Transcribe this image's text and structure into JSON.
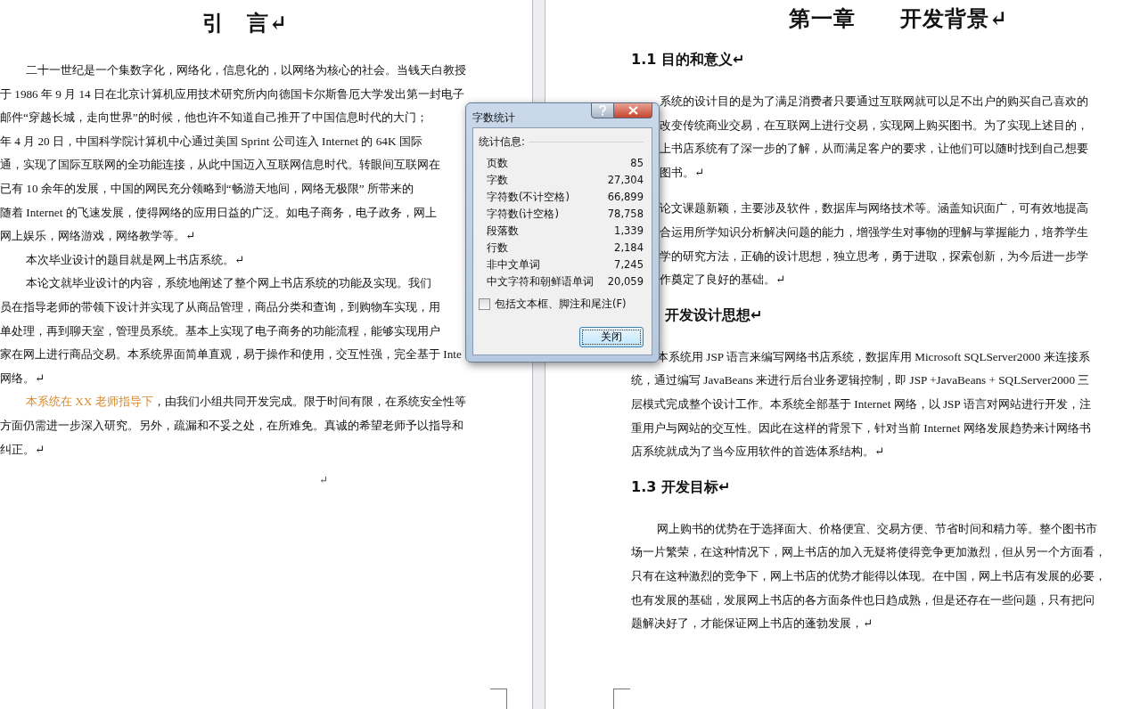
{
  "left_page": {
    "title": "引　言↵",
    "blocks": [
      {
        "kind": "para",
        "lines": [
          "二十一世纪是一个集数字化，网络化，信息化的，以网络为核心的社会。当钱天白教授",
          "于 1986 年 9 月 14 日在北京计算机应用技术研究所内向德国卡尔斯鲁厄大学发出第一封电子",
          "邮件“穿越长城，走向世界”的时候，他也许不知道自己推开了中国信息时代的大门；",
          "年 4 月 20 日，中国科学院计算机中心通过美国 Sprint 公司连入 Internet 的 64K 国际",
          "通，实现了国际互联网的全功能连接，从此中国迈入互联网信息时代。转眼间互联网在",
          "已有 10 余年的发展，中国的网民充分领略到“畅游天地间，网络无极限” 所带来的",
          "随着 Internet 的飞速发展，使得网络的应用日益的广泛。如电子商务，电子政务，网上",
          "网上娱乐，网络游戏，网络教学等。↵"
        ]
      },
      {
        "kind": "para",
        "lines": [
          "本次毕业设计的题目就是网上书店系统。↵"
        ]
      },
      {
        "kind": "para",
        "lines": [
          "本论文就毕业设计的内容，系统地阐述了整个网上书店系统的功能及实现。我们",
          "员在指导老师的带领下设计并实现了从商品管理，商品分类和查询，到购物车实现，用",
          "单处理，再到聊天室，管理员系统。基本上实现了电子商务的功能流程，能够实现用户",
          "家在网上进行商品交易。本系统界面简单直观，易于操作和使用，交互性强，完全基于 Inte",
          "网络。↵"
        ]
      },
      {
        "kind": "para",
        "lines": [
          {
            "spans": [
              {
                "text": "本系统在 XX 老师指导下",
                "highlight": true
              },
              {
                "text": "，由我们小组共同开发完成。限于时间有限，在系统安全性等",
                "highlight": false
              }
            ]
          },
          "方面仍需进一步深入研究。另外，疏漏和不妥之处，在所难免。真诚的希望老师予以指导和",
          "纠正。↵"
        ]
      }
    ],
    "end_mark": "↵"
  },
  "right_page": {
    "title": "第一章　　开发背景↵",
    "blocks": [
      {
        "kind": "heading",
        "under_dialog": false,
        "text": "1.1  目的和意义↵"
      },
      {
        "kind": "para",
        "under_dialog": true,
        "lines": [
          "系统的设计目的是为了满足消费者只要通过互联网就可以足不出户的购买自己喜欢的",
          "改变传统商业交易，在互联网上进行交易，实现网上购买图书。为了实现上述目的，",
          "上书店系统有了深一步的了解，从而满足客户的要求，让他们可以随时找到自己想要",
          "图书。↵"
        ]
      },
      {
        "kind": "para",
        "under_dialog": true,
        "lines": [
          "论文课题新颖，主要涉及软件，数据库与网络技术等。涵盖知识面广，可有效地提高",
          "合运用所学知识分析解决问题的能力，增强学生对事物的理解与掌握能力，培养学生",
          "学的研究方法，正确的设计思想，独立思考，勇于进取，探索创新，为今后进一步学",
          "作奠定了良好的基础。↵"
        ]
      },
      {
        "kind": "heading",
        "under_dialog": true,
        "text": "开发设计思想↵"
      },
      {
        "kind": "para",
        "under_dialog": false,
        "lines": [
          "本系统用 JSP 语言来编写网络书店系统，数据库用 Microsoft SQLServer2000 来连接系",
          "统，通过编写 JavaBeans 来进行后台业务逻辑控制，即 JSP +JavaBeans + SQLServer2000 三",
          "层模式完成整个设计工作。本系统全部基于 Internet 网络，以 JSP 语言对网站进行开发，注",
          "重用户与网站的交互性。因此在这样的背景下，针对当前 Internet 网络发展趋势来计网络书",
          "店系统就成为了当今应用软件的首选体系结构。↵"
        ]
      },
      {
        "kind": "heading",
        "under_dialog": false,
        "text": "1.3  开发目标↵"
      },
      {
        "kind": "para",
        "under_dialog": false,
        "lines": [
          "网上购书的优势在于选择面大、价格便宜、交易方便、节省时间和精力等。整个图书市",
          "场一片繁荣，在这种情况下，网上书店的加入无疑将使得竞争更加激烈，但从另一个方面看，",
          "只有在这种激烈的竞争下，网上书店的优势才能得以体现。在中国，网上书店有发展的必要，",
          "也有发展的基础，发展网上书店的各方面条件也日趋成熟，但是还存在一些问题，只有把问",
          "题解决好了，才能保证网上书店的蓬勃发展，↵"
        ]
      }
    ]
  },
  "dialog": {
    "title": "字数统计",
    "group_label": "统计信息:",
    "stats": [
      {
        "label": "页数",
        "value": "85"
      },
      {
        "label": "字数",
        "value": "27,304"
      },
      {
        "label": "字符数(不计空格)",
        "value": "66,899"
      },
      {
        "label": "字符数(计空格)",
        "value": "78,758"
      },
      {
        "label": "段落数",
        "value": "1,339"
      },
      {
        "label": "行数",
        "value": "2,184"
      },
      {
        "label": "非中文单词",
        "value": "7,245"
      },
      {
        "label": "中文字符和朝鲜语单词",
        "value": "20,059"
      }
    ],
    "checkbox": {
      "label": "包括文本框、脚注和尾注(F)",
      "checked": false
    },
    "button": "关闭"
  }
}
